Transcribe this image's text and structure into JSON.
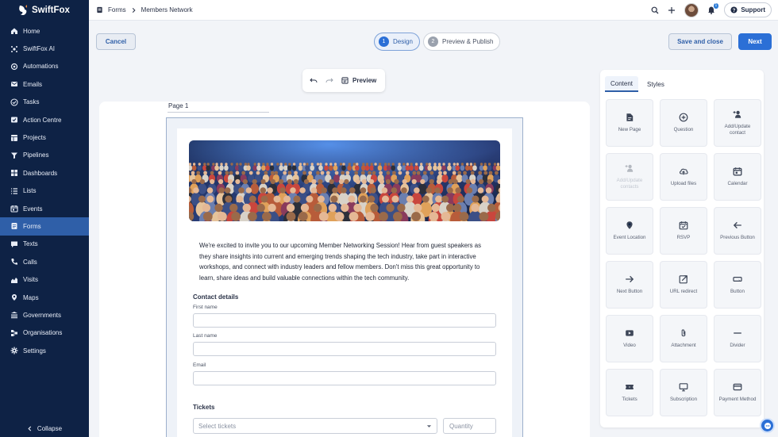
{
  "app": {
    "name": "SwiftFox"
  },
  "sidebar": {
    "items": [
      {
        "label": "Home",
        "icon": "home-icon"
      },
      {
        "label": "SwiftFox AI",
        "icon": "ai-icon"
      },
      {
        "label": "Automations",
        "icon": "automation-icon"
      },
      {
        "label": "Emails",
        "icon": "mail-icon"
      },
      {
        "label": "Tasks",
        "icon": "check-circle-icon"
      },
      {
        "label": "Action Centre",
        "icon": "action-icon"
      },
      {
        "label": "Projects",
        "icon": "projects-icon"
      },
      {
        "label": "Pipelines",
        "icon": "filter-icon"
      },
      {
        "label": "Dashboards",
        "icon": "dashboard-icon"
      },
      {
        "label": "Lists",
        "icon": "list-icon"
      },
      {
        "label": "Events",
        "icon": "calendar-icon"
      },
      {
        "label": "Forms",
        "icon": "form-icon"
      },
      {
        "label": "Texts",
        "icon": "chat-icon"
      },
      {
        "label": "Calls",
        "icon": "phone-icon"
      },
      {
        "label": "Visits",
        "icon": "visits-icon"
      },
      {
        "label": "Maps",
        "icon": "map-icon"
      },
      {
        "label": "Governments",
        "icon": "government-icon"
      },
      {
        "label": "Organisations",
        "icon": "org-icon"
      },
      {
        "label": "Settings",
        "icon": "gear-icon"
      }
    ],
    "active": "Forms",
    "collapse_label": "Collapse"
  },
  "breadcrumb": {
    "parent": "Forms",
    "current": "Members Network"
  },
  "topbar": {
    "notification_count": "1",
    "support_label": "Support"
  },
  "steps": {
    "cancel_label": "Cancel",
    "step1_num": "1",
    "step1_label": "Design",
    "step2_num": "2",
    "step2_label": "Preview & Publish",
    "save_label": "Save and close",
    "next_label": "Next"
  },
  "editor": {
    "preview_label": "Preview",
    "page_tab": "Page 1"
  },
  "form": {
    "intro": "We're excited to invite you to our upcoming Member Networking Session! Hear from guest speakers as they share insights into current and emerging trends shaping the tech industry, take part in interactive workshops, and connect with industry leaders and fellow members. Don't miss this great opportunity to learn, share ideas and build valuable connections within the tech community.",
    "contact_title": "Contact details",
    "first_name_label": "First name",
    "last_name_label": "Last name",
    "email_label": "Email",
    "tickets_title": "Tickets",
    "tickets_placeholder": "Select tickets",
    "quantity_placeholder": "Quantity"
  },
  "panel": {
    "tab_content": "Content",
    "tab_styles": "Styles",
    "tiles": [
      {
        "label": "New Page",
        "icon": "new-page-icon",
        "disabled": false
      },
      {
        "label": "Question",
        "icon": "plus-circle-icon",
        "disabled": false
      },
      {
        "label": "Add/Update contact",
        "icon": "add-contact-icon",
        "disabled": false
      },
      {
        "label": "Add/Update contacts",
        "icon": "add-contacts-icon",
        "disabled": true
      },
      {
        "label": "Upload files",
        "icon": "cloud-upload-icon",
        "disabled": false
      },
      {
        "label": "Calendar",
        "icon": "calendar-icon",
        "disabled": false
      },
      {
        "label": "Event Location",
        "icon": "map-icon",
        "disabled": false
      },
      {
        "label": "RSVP",
        "icon": "rsvp-icon",
        "disabled": false
      },
      {
        "label": "Previous Button",
        "icon": "arrow-left-icon",
        "disabled": false
      },
      {
        "label": "Next Button",
        "icon": "arrow-right-icon",
        "disabled": false
      },
      {
        "label": "URL redirect",
        "icon": "external-link-icon",
        "disabled": false
      },
      {
        "label": "Button",
        "icon": "button-icon",
        "disabled": false
      },
      {
        "label": "Video",
        "icon": "video-icon",
        "disabled": false
      },
      {
        "label": "Attachment",
        "icon": "paperclip-icon",
        "disabled": false
      },
      {
        "label": "Divider",
        "icon": "divider-icon",
        "disabled": false
      },
      {
        "label": "Tickets",
        "icon": "ticket-icon",
        "disabled": false
      },
      {
        "label": "Subscription",
        "icon": "subscription-icon",
        "disabled": false
      },
      {
        "label": "Payment Method",
        "icon": "credit-card-icon",
        "disabled": false
      }
    ]
  },
  "colors": {
    "sidebar": "#0e2245",
    "active": "#2f5fa8",
    "primary": "#2b6fd6"
  }
}
